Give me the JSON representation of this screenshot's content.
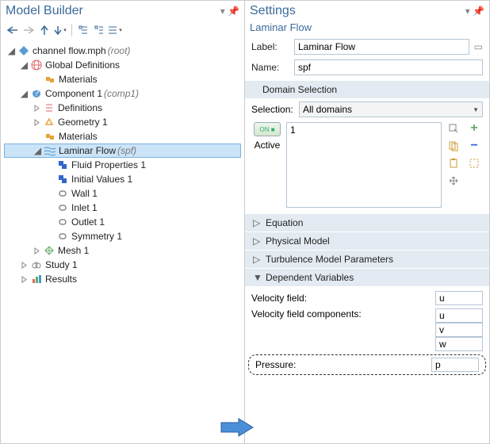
{
  "left": {
    "title": "Model Builder",
    "tree": {
      "root": {
        "label": "channel flow.mph",
        "suffix": "(root)"
      },
      "global_defs": "Global Definitions",
      "global_materials": "Materials",
      "component": {
        "label": "Component 1",
        "suffix": "(comp1)"
      },
      "definitions": "Definitions",
      "geometry": "Geometry 1",
      "comp_materials": "Materials",
      "laminar": {
        "label": "Laminar Flow",
        "suffix": "(spf)"
      },
      "fluid_props": "Fluid Properties 1",
      "initial_vals": "Initial Values 1",
      "wall": "Wall 1",
      "inlet": "Inlet 1",
      "outlet": "Outlet 1",
      "symmetry": "Symmetry 1",
      "mesh": "Mesh 1",
      "study": "Study 1",
      "results": "Results"
    }
  },
  "right": {
    "title": "Settings",
    "subtitle": "Laminar Flow",
    "label_field": {
      "label": "Label:",
      "value": "Laminar Flow"
    },
    "name_field": {
      "label": "Name:",
      "value": "spf"
    },
    "domain_sel_title": "Domain Selection",
    "selection": {
      "label": "Selection:",
      "value": "All domains"
    },
    "active_label": "Active",
    "listbox_item": "1",
    "sections": {
      "equation": "Equation",
      "physical": "Physical Model",
      "turbulence": "Turbulence Model Parameters",
      "depvars": "Dependent Variables"
    },
    "depvars": {
      "velocity_label": "Velocity field:",
      "velocity_value": "u",
      "components_label": "Velocity field components:",
      "components": [
        "u",
        "v",
        "w"
      ],
      "pressure_label": "Pressure:",
      "pressure_value": "p"
    }
  }
}
